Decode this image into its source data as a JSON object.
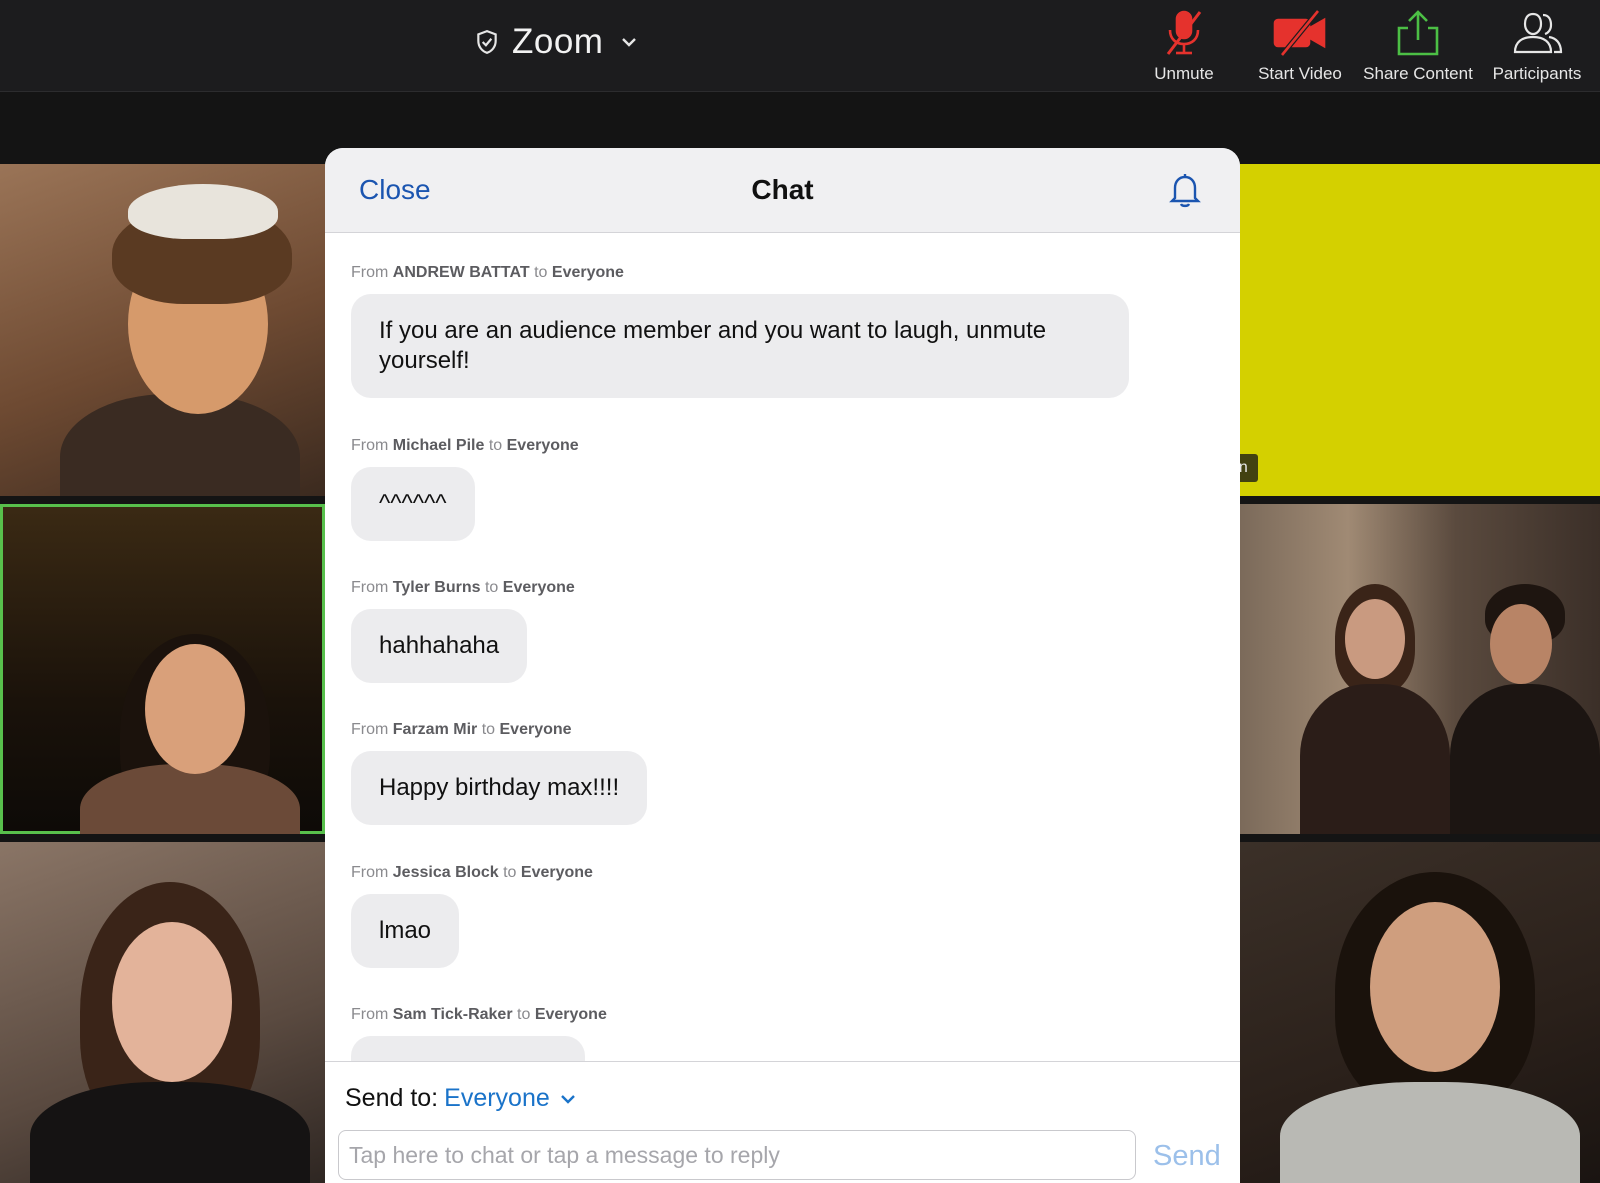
{
  "window": {
    "title": "Zoom",
    "title_icon": "shield-check-icon",
    "title_dropdown_icon": "chevron-down-icon"
  },
  "toolbar": {
    "items": [
      {
        "label": "Unmute",
        "icon": "microphone-muted-icon",
        "color": "#e5322d"
      },
      {
        "label": "Start Video",
        "icon": "video-off-icon",
        "color": "#e5322d"
      },
      {
        "label": "Share Content",
        "icon": "share-upload-icon",
        "color": "#4cbf45"
      },
      {
        "label": "Participants",
        "icon": "participants-icon",
        "color": "#e6e6e6"
      }
    ]
  },
  "gallery": {
    "tiles": [
      {
        "position": "left-1",
        "speaking": false
      },
      {
        "position": "left-2",
        "speaking": true
      },
      {
        "position": "left-3",
        "speaking": false
      },
      {
        "position": "right-1",
        "speaking": false,
        "name_tag": "an",
        "background": "#d4d000"
      },
      {
        "position": "right-2",
        "speaking": false
      },
      {
        "position": "right-3",
        "speaking": false
      }
    ],
    "speaking_color": "#58c04c"
  },
  "chat": {
    "close_label": "Close",
    "title": "Chat",
    "bell_icon": "bell-icon",
    "from_label": "From",
    "to_label": "to",
    "messages": [
      {
        "sender": "ANDREW BATTAT",
        "recipient": "Everyone",
        "text": "If you are an audience member and you want to laugh, unmute yourself!"
      },
      {
        "sender": "Michael Pile",
        "recipient": "Everyone",
        "text": "^^^^^^"
      },
      {
        "sender": "Tyler Burns",
        "recipient": "Everyone",
        "text": "hahhahaha"
      },
      {
        "sender": "Farzam Mir",
        "recipient": "Everyone",
        "text": "Happy birthday max!!!!"
      },
      {
        "sender": "Jessica Block",
        "recipient": "Everyone",
        "text": "lmao"
      },
      {
        "sender": "Sam Tick-Raker",
        "recipient": "Everyone",
        "text": ""
      }
    ],
    "send_to_label": "Send to:",
    "send_to_value": "Everyone",
    "input_placeholder": "Tap here to chat or tap a message to reply",
    "send_label": "Send",
    "accent_color": "#1a73c9"
  }
}
